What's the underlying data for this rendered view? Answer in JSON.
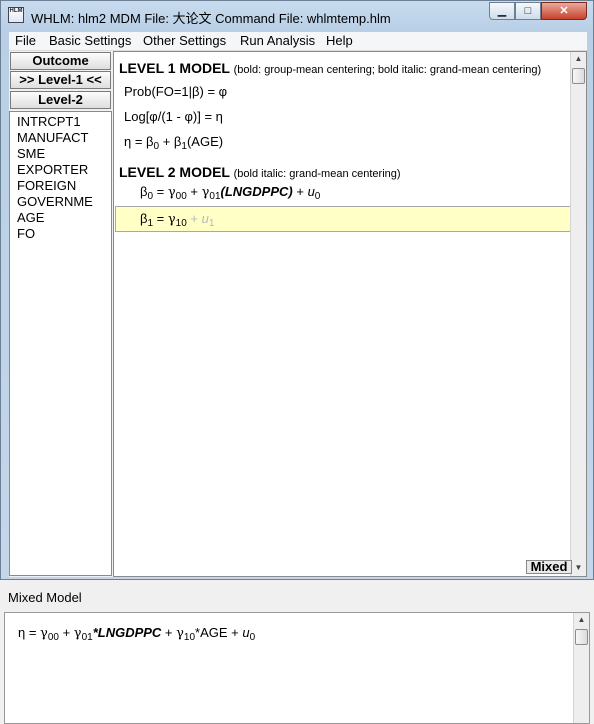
{
  "window": {
    "title": "WHLM: hlm2 MDM File: 大论文   Command File: whlmtemp.hlm",
    "icon_text": "HLM",
    "min_glyph": "▁",
    "max_glyph": "□",
    "close_glyph": "✕"
  },
  "menu": [
    "File",
    "Basic Settings",
    "Other Settings",
    "Run Analysis",
    "Help"
  ],
  "left_panel": {
    "buttons": [
      "Outcome",
      ">> Level-1 <<",
      "Level-2"
    ],
    "variables": [
      "INTRCPT1",
      "MANUFACT",
      "SME",
      "EXPORTER",
      "FOREIGN",
      "GOVERNME",
      "AGE",
      "FO"
    ]
  },
  "level1": {
    "header": "LEVEL 1 MODEL",
    "note": "(bold: group-mean centering; bold italic: grand-mean centering)",
    "eq1": "Prob(FO=1|β) = φ",
    "eq2": "Log[φ/(1 - φ)] = η",
    "eq3_start": "η  =  β",
    "eq3_sub0": "0",
    "eq3_mid": " + β",
    "eq3_sub1": "1",
    "eq3_end": "(AGE)"
  },
  "level2": {
    "header": "LEVEL 2 MODEL",
    "note": "(bold italic: grand-mean centering)",
    "b0": "β",
    "b0_sub": "0",
    "b0_eq": "  =  ",
    "g00": "γ",
    "g00_sub": "00",
    "plus1": " + ",
    "g01": "γ",
    "g01_sub": "01",
    "lng": "(LNGDPPC)",
    "plus2": " + ",
    "u0": "u",
    "u0_sub": "0",
    "b1": "β",
    "b1_sub": "1",
    "b1_eq": "  =  ",
    "g10": "γ",
    "g10_sub": "10",
    "plus3": " + ",
    "u1": "u",
    "u1_sub": "1"
  },
  "mixed_button": "Mixed",
  "mixed_model": {
    "title": "Mixed Model",
    "eta": "η  =  ",
    "g00": "γ",
    "g00_sub": "00",
    "p1": " + ",
    "g01": "γ",
    "g01_sub": "01",
    "lng": "*LNGDPPC",
    "p2": " + ",
    "g10": "γ",
    "g10_sub": "10",
    "age": "*AGE",
    "p3": " + ",
    "u0": "u",
    "u0_sub": "0"
  }
}
